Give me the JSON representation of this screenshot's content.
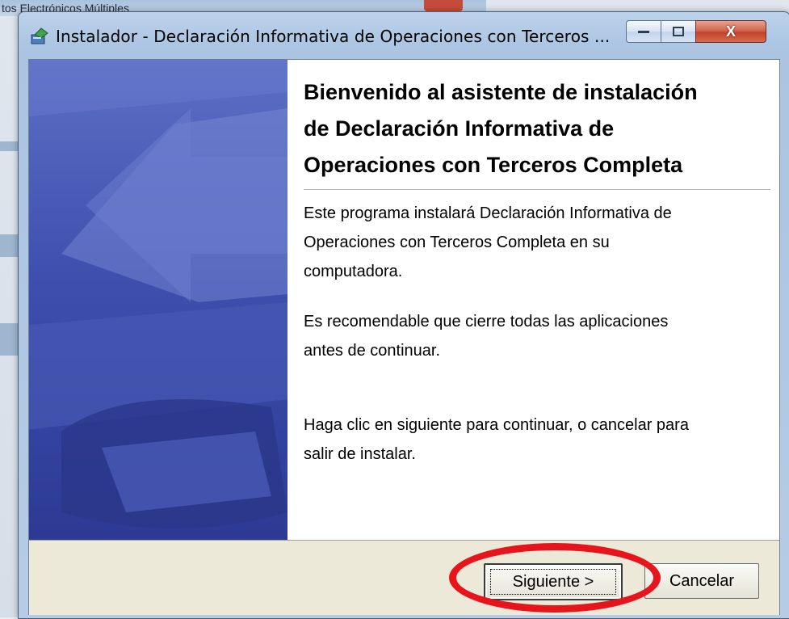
{
  "background_window": {
    "title_fragment": "tos Electrónicos Múltiples"
  },
  "window": {
    "title": "Instalador - Declaración Informativa de Operaciones con Terceros ...",
    "icon": "installer-icon",
    "controls": {
      "minimize_icon": "minimize-icon",
      "maximize_icon": "maximize-icon",
      "close_label": "X"
    }
  },
  "welcome": {
    "heading_line1": "Bienvenido al asistente de instalación",
    "heading_line2": "de Declaración Informativa de",
    "heading_line3": "Operaciones con Terceros Completa",
    "paragraph1_line1": "Este programa instalará Declaración Informativa de",
    "paragraph1_line2": "Operaciones con Terceros Completa en su",
    "paragraph1_line3": "computadora.",
    "paragraph2_line1": "Es recomendable que cierre todas las aplicaciones",
    "paragraph2_line2": "antes de continuar.",
    "paragraph3_line1": "Haga clic en siguiente para continuar, o cancelar para",
    "paragraph3_line2": "salir de instalar."
  },
  "footer": {
    "next_label": "Siguiente >",
    "cancel_label": "Cancelar"
  },
  "colors": {
    "banner": "#3e4fae",
    "highlight_ring": "#e8141b"
  }
}
